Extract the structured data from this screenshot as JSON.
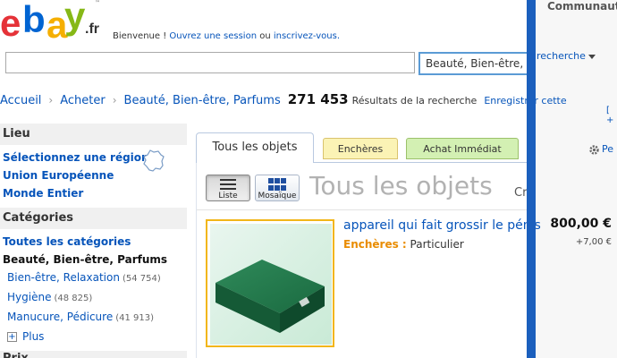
{
  "header": {
    "logo": {
      "letters": [
        "e",
        "b",
        "a",
        "y"
      ],
      "suffix": ".fr",
      "trademark": "™"
    },
    "welcome_prefix": "Bienvenue ! ",
    "signin_link": "Ouvrez une session",
    "welcome_middle": " ou ",
    "register_link": "inscrivez-vous.",
    "welcome_suffix": "",
    "search_value": "",
    "category_select": "Beauté, Bien-être, Pa",
    "right_link": "Communauté",
    "advanced_search": "recherche",
    "bracket": "[ +"
  },
  "breadcrumb": {
    "items": [
      "Accueil",
      "Acheter",
      "Beauté, Bien-être, Parfums"
    ],
    "count": "271 453",
    "results_label": "Résultats de la recherche",
    "save_link": "Enregistrer cette"
  },
  "sidebar": {
    "lieu": {
      "heading": "Lieu",
      "items": [
        "Sélectionnez une région",
        "Union Européenne",
        "Monde Entier"
      ]
    },
    "categories": {
      "heading": "Catégories",
      "all": "Toutes les catégories",
      "current": "Beauté, Bien-être, Parfums",
      "subs": [
        {
          "label": "Bien-être, Relaxation",
          "count": "(54 754)"
        },
        {
          "label": "Hygiène",
          "count": "(48 825)"
        },
        {
          "label": "Manucure, Pédicure",
          "count": "(41 913)"
        }
      ],
      "more": "Plus"
    },
    "price_heading": "Prix"
  },
  "tabs": {
    "all": "Tous les objets",
    "auctions": "Enchères",
    "buy_now": "Achat Immédiat",
    "personalize": "Pe"
  },
  "view": {
    "list_label": "Liste",
    "mosaic_label": "Mosaïque",
    "title": "Tous les objets",
    "sort_prefix": "Cr"
  },
  "listing": {
    "title": "appareil qui fait grossir le pénis",
    "format": "Enchères :",
    "seller_type": "Particulier",
    "price": "800,00 €",
    "shipping": "+7,00 €"
  },
  "colors": {
    "ebay_red": "#e53238",
    "ebay_blue": "#0064d2",
    "ebay_yellow": "#f5af02",
    "ebay_green": "#86b817",
    "link": "#0654ba",
    "auction_orange": "#e98c00",
    "divider_blue": "#1b5fbd"
  }
}
